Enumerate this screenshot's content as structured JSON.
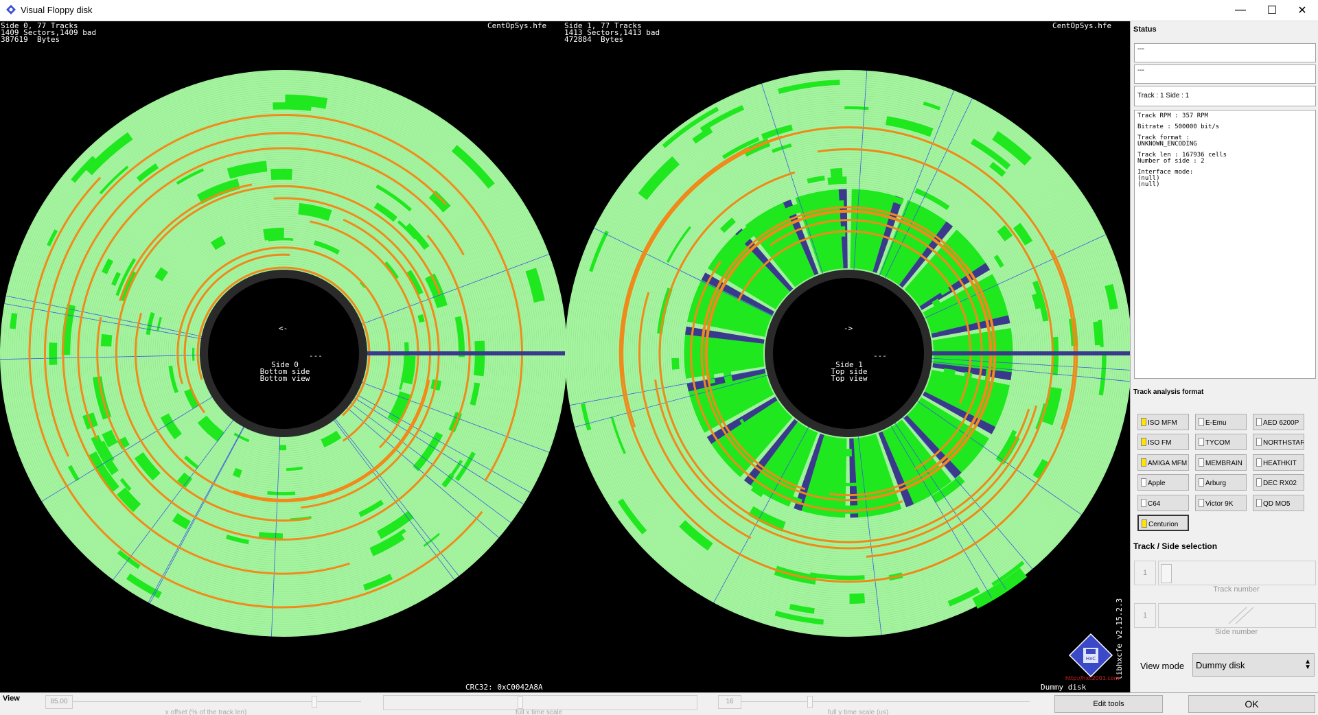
{
  "window": {
    "title": "Visual Floppy disk",
    "minimize": "—",
    "maximize": "☐",
    "close": "✕"
  },
  "side0": {
    "header": [
      "Side 0, 77 Tracks",
      "1409 Sectors,1409 bad",
      "387619  Bytes"
    ],
    "file": "CentOpSys.hfe",
    "arrow": "<-",
    "dash": "---",
    "center": [
      "Side 0",
      "Bottom side",
      "Bottom view"
    ]
  },
  "side1": {
    "header": [
      "Side 1, 77 Tracks",
      "1413 Sectors,1413 bad",
      "472884  Bytes"
    ],
    "file": "CentOpSys.hfe",
    "arrow": "->",
    "dash": "---",
    "center": [
      "Side 1",
      "Top side",
      "Top view"
    ]
  },
  "crc": "CRC32: 0xC0042A8A",
  "dummy_label": "Dummy disk",
  "version": "libhxcfe v2.15.2.3",
  "logo_url": "http://hxc2001.com",
  "status": {
    "label": "Status",
    "field1": "---",
    "field2": "---",
    "field3": "Track : 1 Side : 1",
    "info": [
      "Track RPM : 357 RPM",
      "",
      "Bitrate : 500000 bit/s",
      "",
      "Track format :",
      "UNKNOWN_ENCODING",
      "",
      "Track len : 167936 cells",
      "Number of side : 2",
      "",
      "Interface mode:",
      "(null)",
      "(null)"
    ]
  },
  "formats": {
    "label": "Track analysis format",
    "items": [
      {
        "label": "ISO MFM",
        "on": true
      },
      {
        "label": "E-Emu",
        "on": false
      },
      {
        "label": "AED 6200P",
        "on": false
      },
      {
        "label": "ISO FM",
        "on": true
      },
      {
        "label": "TYCOM",
        "on": false
      },
      {
        "label": "NORTHSTAR",
        "on": false
      },
      {
        "label": "AMIGA MFM",
        "on": true
      },
      {
        "label": "MEMBRAIN",
        "on": false
      },
      {
        "label": "HEATHKIT",
        "on": false
      },
      {
        "label": "Apple",
        "on": false
      },
      {
        "label": "Arburg",
        "on": false
      },
      {
        "label": "DEC RX02",
        "on": false
      },
      {
        "label": "C64",
        "on": false
      },
      {
        "label": "Victor 9K",
        "on": false
      },
      {
        "label": "QD MO5",
        "on": false
      },
      {
        "label": "Centurion",
        "on": true
      }
    ]
  },
  "selection": {
    "label": "Track / Side selection",
    "track_value": "1",
    "track_caption": "Track number",
    "side_value": "1",
    "side_caption": "Side number",
    "view_mode_label": "View mode",
    "view_mode_value": "Dummy disk"
  },
  "bottom": {
    "view_label": "View",
    "x_offset_value": "85.00",
    "x_offset_caption": "x offset (% of the track len)",
    "full_time_caption": "full x time scale",
    "y_value": "16",
    "y_caption": "full y time scale (us)",
    "edit_tools": "Edit tools",
    "ok": "OK"
  },
  "colors": {
    "track_light": "#a5f5a0",
    "sector_green": "#1fe81f",
    "orange": "#f08a1a",
    "bad_blue": "#3a3a8c",
    "hub": "#000000"
  }
}
